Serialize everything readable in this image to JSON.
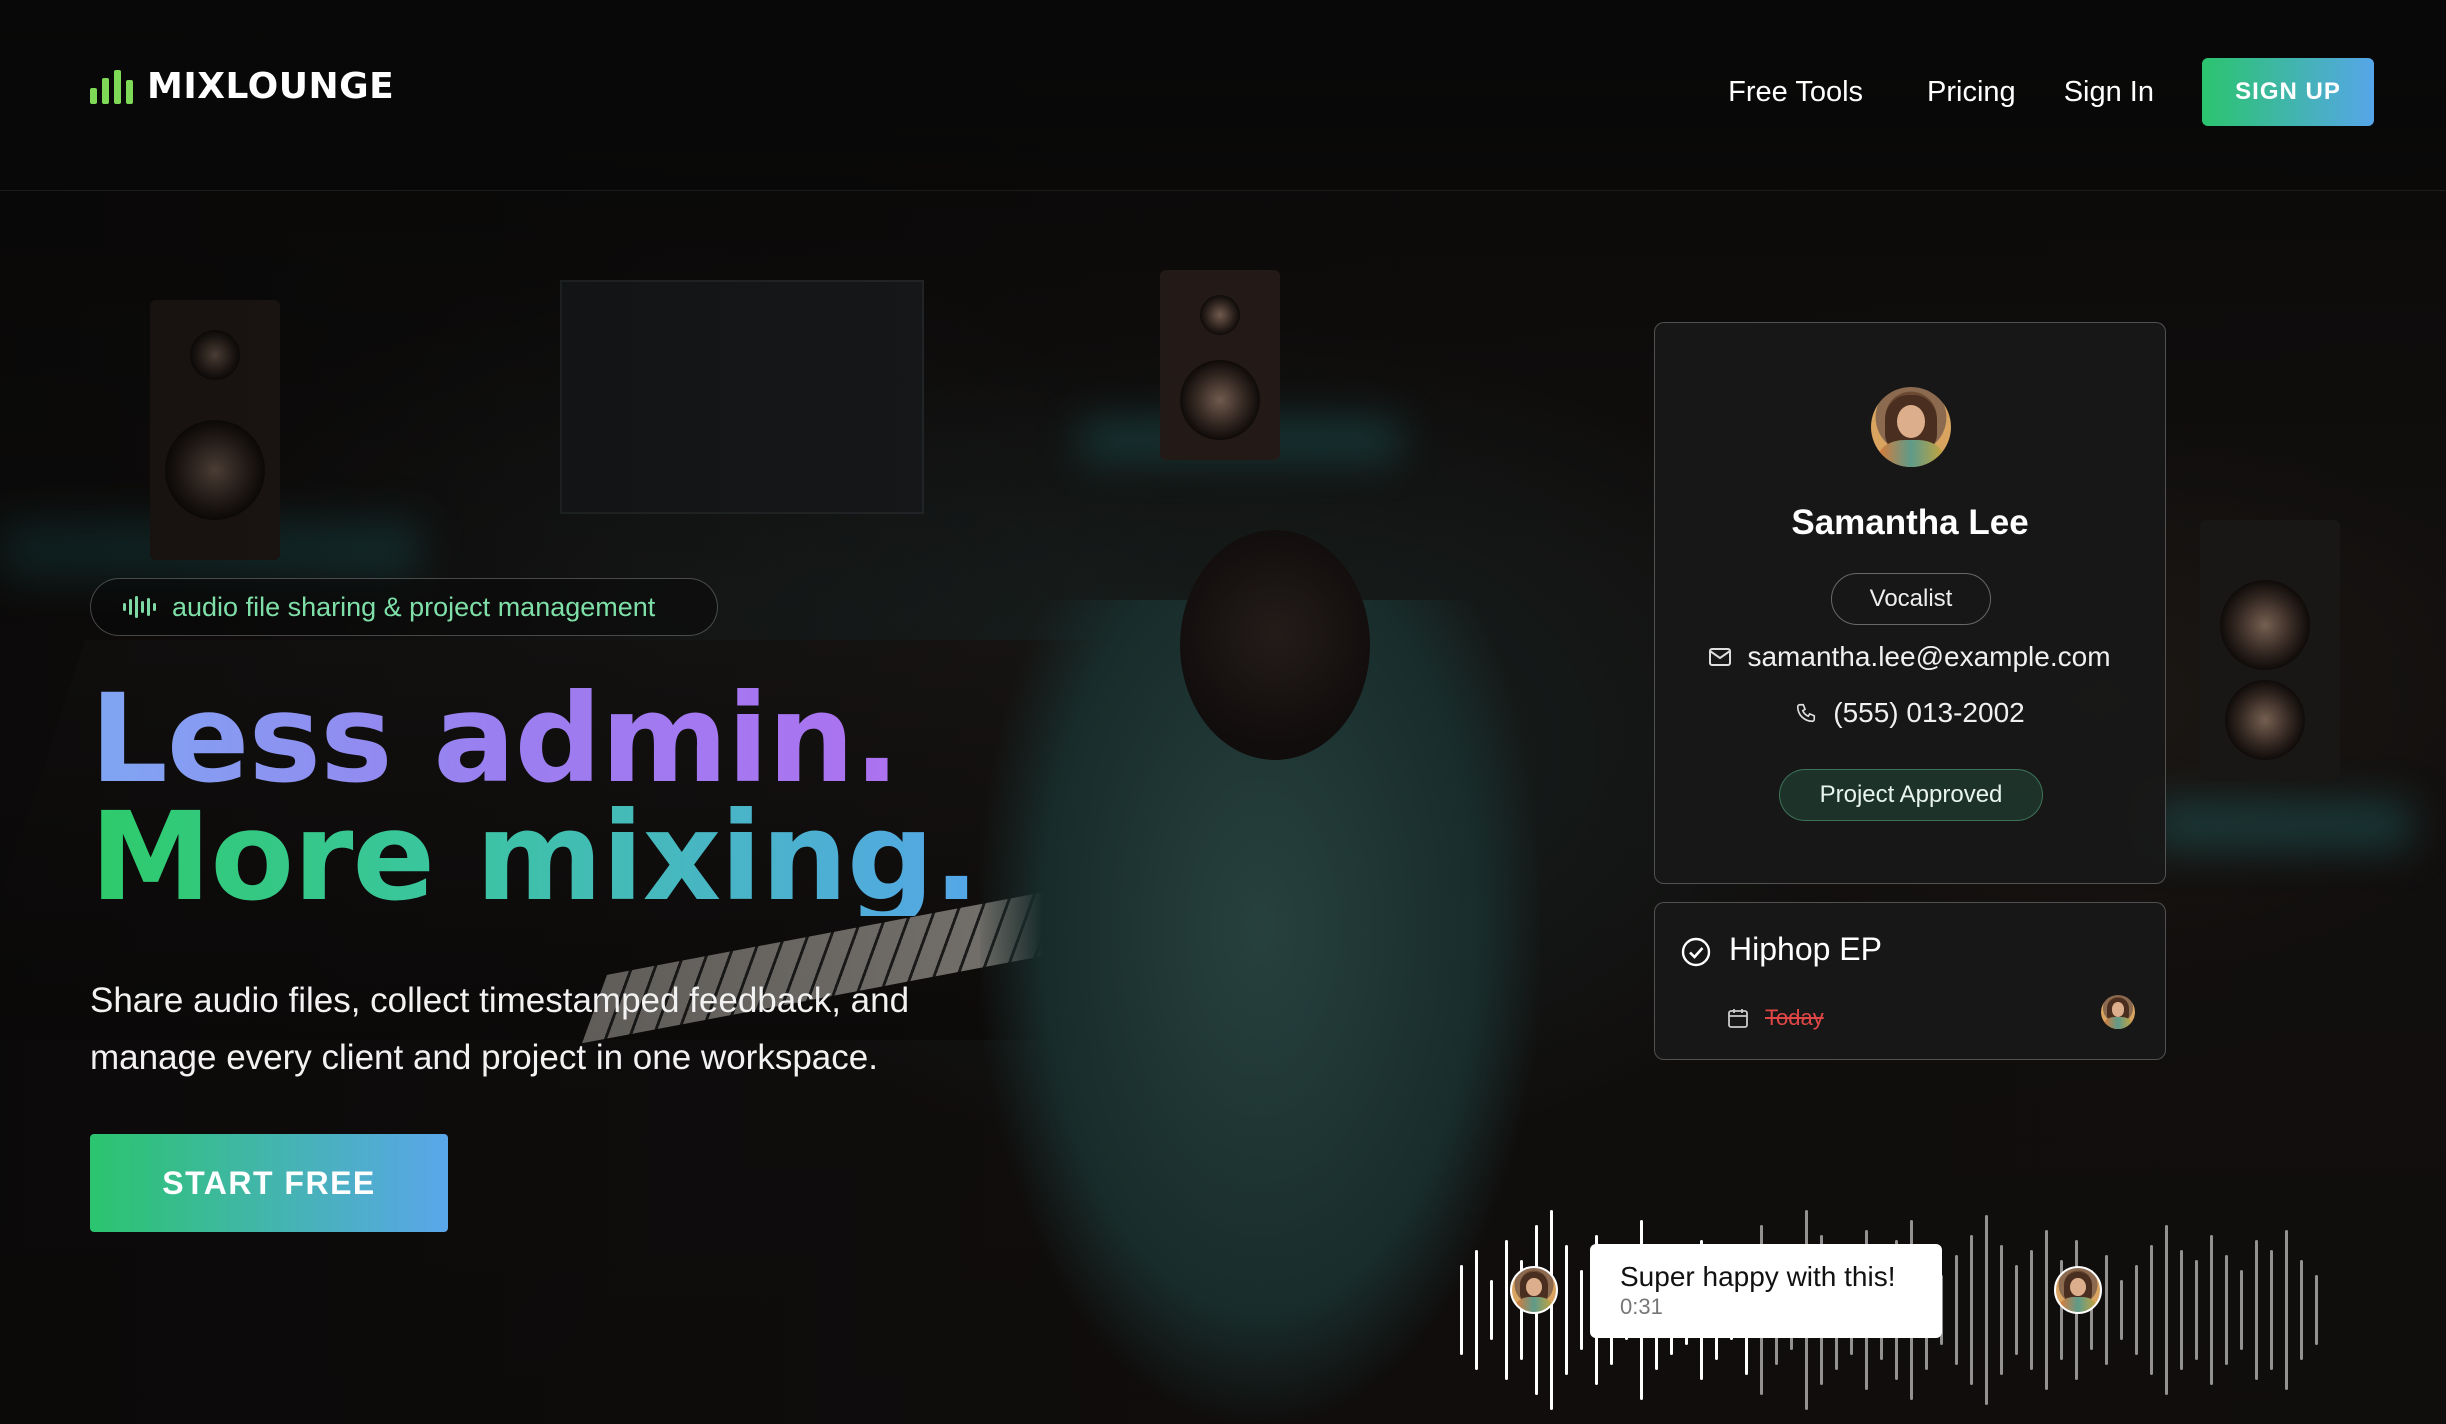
{
  "brand": {
    "name": "MIXLOUNGE",
    "accent": "#7ed957"
  },
  "nav": {
    "free_tools": "Free Tools",
    "pricing": "Pricing",
    "sign_in": "Sign In",
    "sign_up": "SIGN UP"
  },
  "hero": {
    "tagline": "audio file sharing & project management",
    "headline_line1": "Less admin.",
    "headline_line2": "More mixing.",
    "subtext": "Share audio files, collect timestamped feedback, and manage every client and project in one workspace.",
    "cta": "START FREE"
  },
  "profile_card": {
    "name": "Samantha Lee",
    "role": "Vocalist",
    "email": "samantha.lee@example.com",
    "phone": "(555) 013-2002",
    "status": "Project Approved"
  },
  "task_card": {
    "title": "Hiphop EP",
    "due": "Today"
  },
  "comment": {
    "text": "Super happy with this!",
    "timestamp": "0:31"
  },
  "colors": {
    "gradient_green": "#2bc46e",
    "gradient_blue": "#56a6e8",
    "headline_purple": "#b06ff0",
    "tag_green": "#7ee0a8",
    "overdue_red": "#e04646"
  }
}
